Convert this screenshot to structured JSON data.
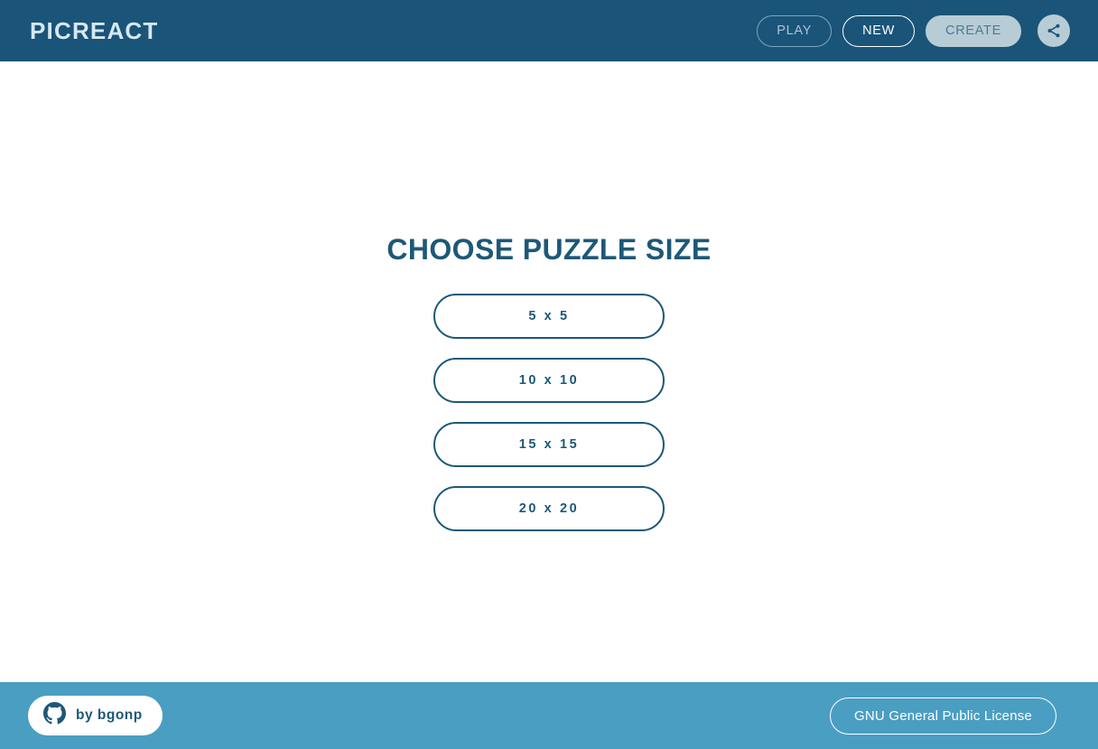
{
  "header": {
    "brand": "PICREACT",
    "nav": [
      {
        "label": "PLAY",
        "state": "idle",
        "name": "nav-play-button"
      },
      {
        "label": "NEW",
        "state": "active",
        "name": "nav-new-button"
      },
      {
        "label": "CREATE",
        "state": "disabled",
        "name": "nav-create-button"
      }
    ],
    "share_icon": "share-icon"
  },
  "main": {
    "title": "CHOOSE PUZZLE SIZE",
    "sizes": [
      {
        "label": "5 x 5"
      },
      {
        "label": "10 x 10"
      },
      {
        "label": "15 x 15"
      },
      {
        "label": "20 x 20"
      }
    ]
  },
  "footer": {
    "author_icon": "github-icon",
    "author_label": "by bgonp",
    "license_label": "GNU General Public License"
  },
  "colors": {
    "header_bg": "#1a5478",
    "footer_bg": "#4a9ec2",
    "body_bg": "#ffffff",
    "accent": "#1d5878",
    "brand_text": "#d5e8f2",
    "idle_border": "#7ea7bf",
    "idle_text": "#a8c5d6",
    "disabled_bg": "#b8ccd6",
    "disabled_text": "#4a7a96"
  }
}
